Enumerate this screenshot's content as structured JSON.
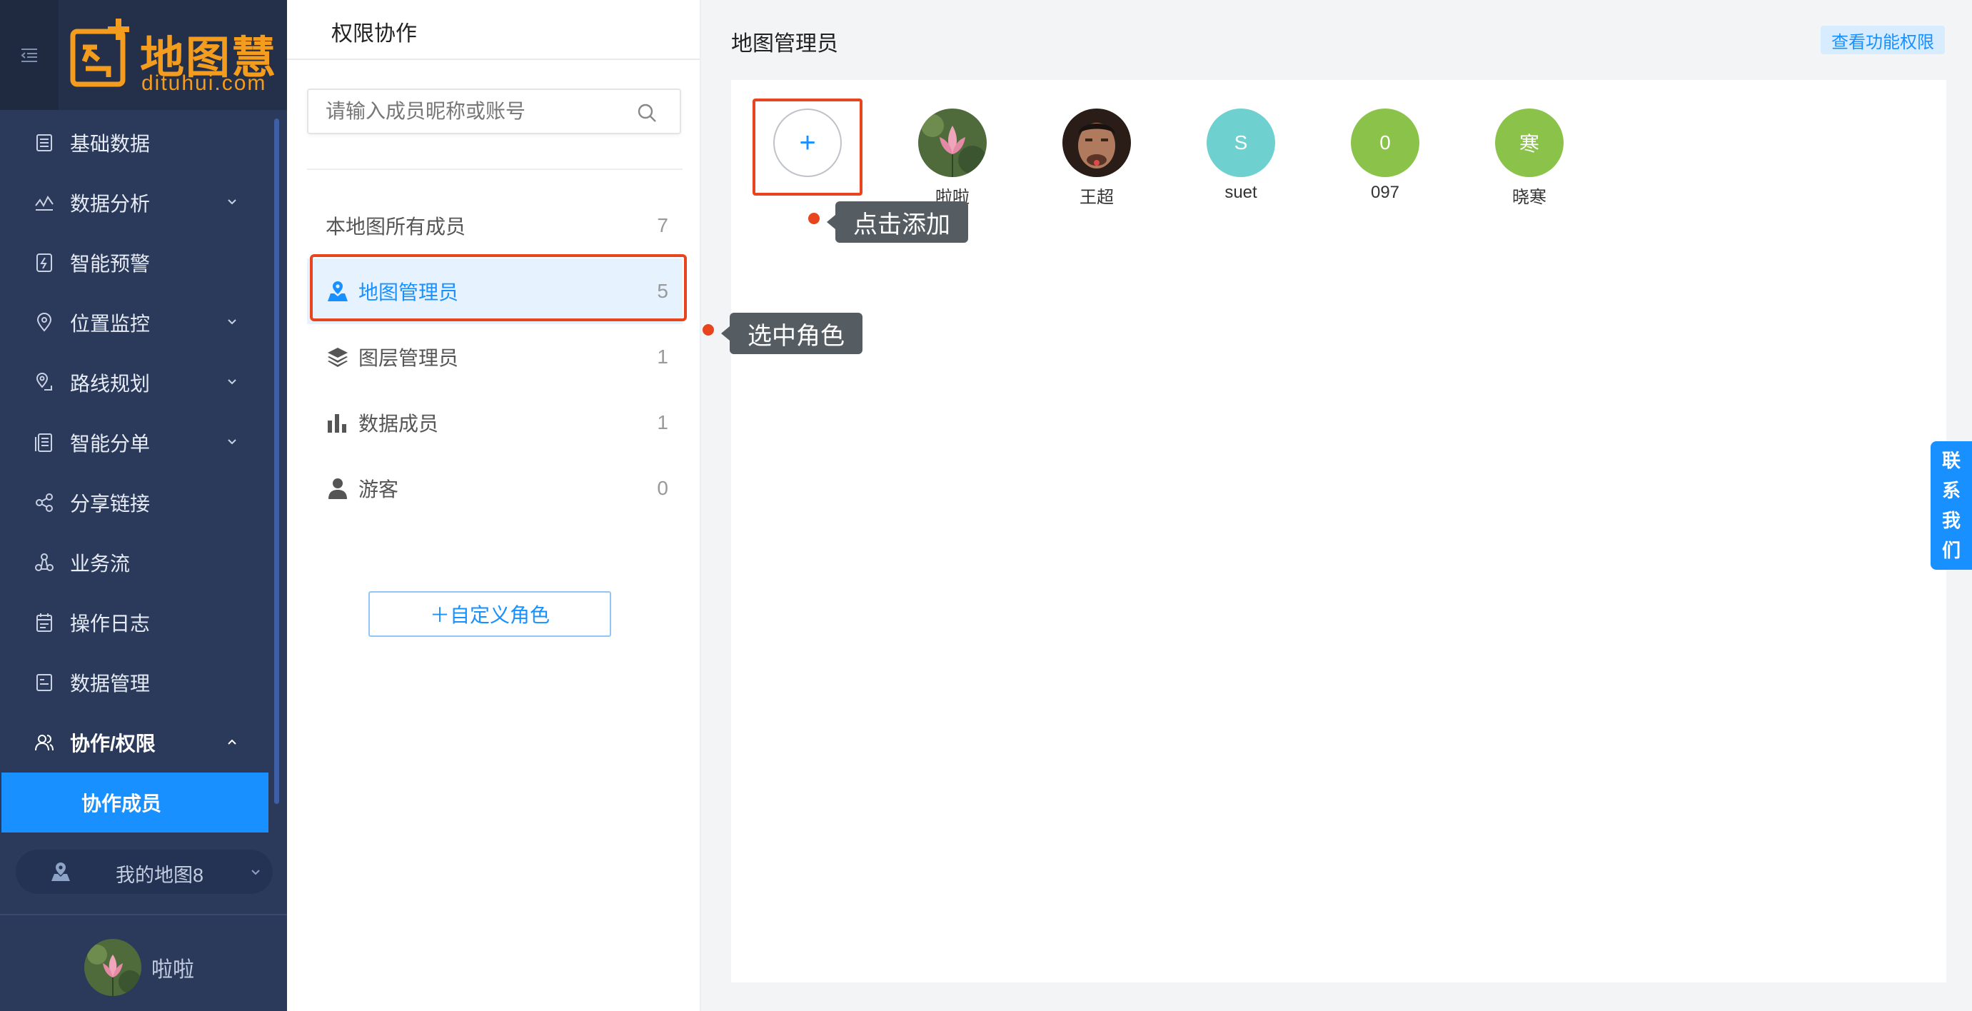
{
  "brand": {
    "name": "地图慧",
    "domain": "dituhui.com",
    "color": "#f39c1e"
  },
  "sidebar": {
    "items": [
      {
        "label": "基础数据",
        "icon": "database-icon",
        "has_arrow": false
      },
      {
        "label": "数据分析",
        "icon": "analysis-icon",
        "has_arrow": true
      },
      {
        "label": "智能预警",
        "icon": "alert-icon",
        "has_arrow": false
      },
      {
        "label": "位置监控",
        "icon": "location-icon",
        "has_arrow": true
      },
      {
        "label": "路线规划",
        "icon": "route-icon",
        "has_arrow": true
      },
      {
        "label": "智能分单",
        "icon": "order-icon",
        "has_arrow": true
      },
      {
        "label": "分享链接",
        "icon": "share-icon",
        "has_arrow": false
      },
      {
        "label": "业务流",
        "icon": "workflow-icon",
        "has_arrow": false
      },
      {
        "label": "操作日志",
        "icon": "log-icon",
        "has_arrow": false
      },
      {
        "label": "数据管理",
        "icon": "data-manage-icon",
        "has_arrow": false
      },
      {
        "label": "协作/权限",
        "icon": "users-icon",
        "has_arrow": true,
        "expanded": true
      }
    ],
    "sub_item": "协作成员",
    "map_select": "我的地图8",
    "user_name": "啦啦"
  },
  "middle": {
    "title": "权限协作",
    "search_placeholder": "请输入成员昵称或账号",
    "roles": [
      {
        "label": "本地图所有成员",
        "count": "7",
        "icon": "",
        "active": false
      },
      {
        "label": "地图管理员",
        "count": "5",
        "icon": "map-admin-icon",
        "active": true
      },
      {
        "label": "图层管理员",
        "count": "1",
        "icon": "layers-icon",
        "active": false
      },
      {
        "label": "数据成员",
        "count": "1",
        "icon": "bar-chart-icon",
        "active": false
      },
      {
        "label": "游客",
        "count": "0",
        "icon": "person-icon",
        "active": false
      }
    ],
    "add_role_label": "＋自定义角色"
  },
  "main": {
    "title": "地图管理员",
    "perm_button": "查看功能权限",
    "add_symbol": "+",
    "members": [
      {
        "name": "啦啦",
        "avatar_type": "image",
        "avatar_text": ""
      },
      {
        "name": "王超",
        "avatar_type": "image",
        "avatar_text": ""
      },
      {
        "name": "suet",
        "avatar_type": "initial",
        "avatar_text": "S",
        "color": "#6fd1cf"
      },
      {
        "name": "097",
        "avatar_type": "initial",
        "avatar_text": "0",
        "color": "#8bc34a"
      },
      {
        "name": "晓寒",
        "avatar_type": "initial",
        "avatar_text": "寒",
        "color": "#8bc34a"
      }
    ]
  },
  "annotations": {
    "add_tip": "点击添加",
    "role_tip": "选中角色",
    "accent": "#e8451e"
  },
  "contact": {
    "chars": [
      "联",
      "系",
      "我",
      "们"
    ]
  },
  "colors": {
    "primary": "#1890ff",
    "sidebar_bg": "#2b3a5a"
  }
}
